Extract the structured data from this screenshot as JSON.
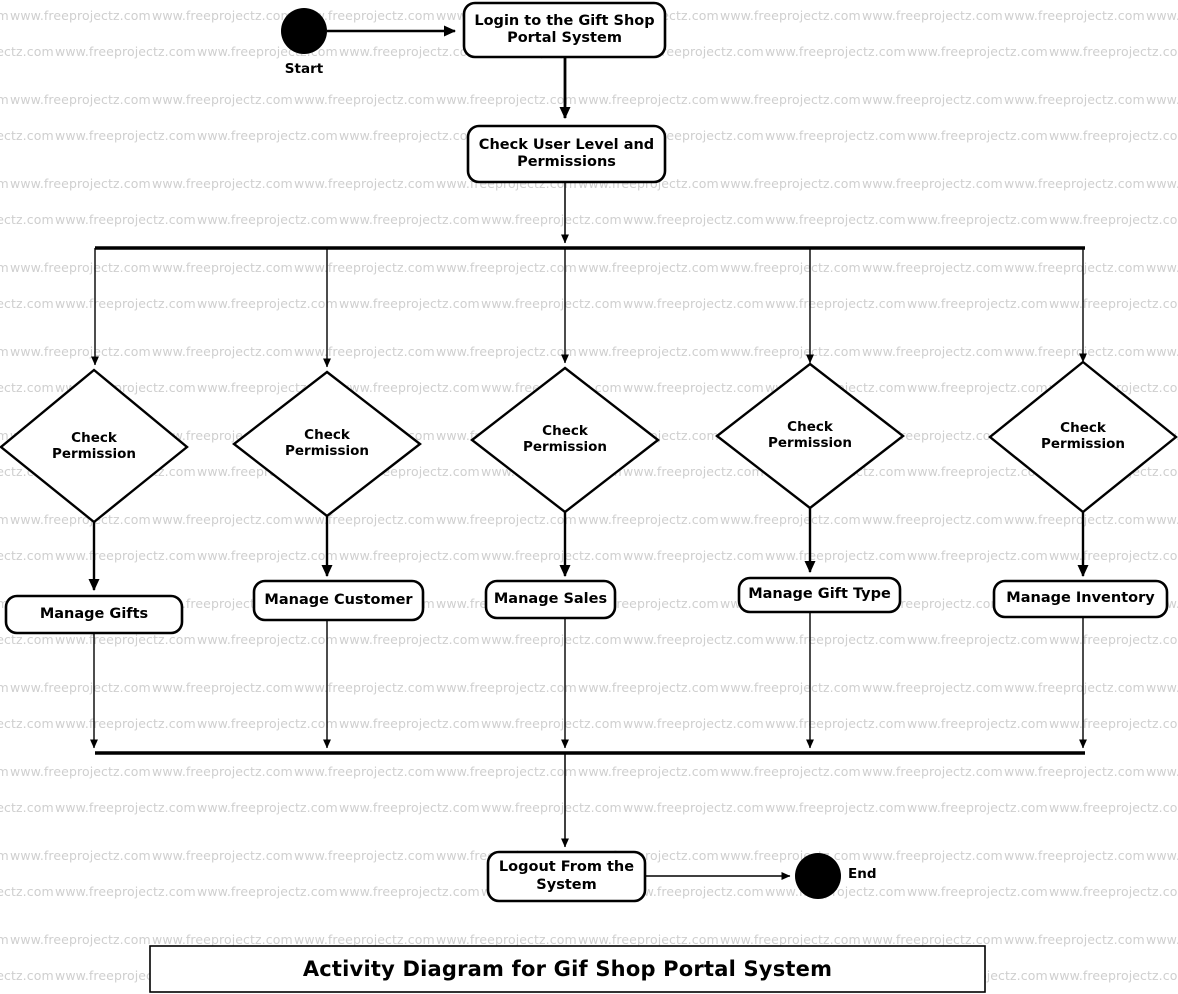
{
  "diagram": {
    "title": "Activity Diagram for Gif Shop Portal System",
    "watermark_text": "www.freeprojectz.com",
    "colors": {
      "stroke": "#000000",
      "fill": "#ffffff",
      "watermark": "#cfcfcf",
      "background": "#ffffff"
    },
    "start_node": {
      "label": "Start"
    },
    "end_node": {
      "label": "End"
    },
    "activities": {
      "login": "Login to the Gift Shop\nPortal System",
      "check_user": "Check User Level and\nPermissions",
      "logout": "Logout From the\nSystem"
    },
    "decisions": [
      {
        "label": "Check\nPermission"
      },
      {
        "label": "Check\nPermission"
      },
      {
        "label": "Check\nPermission"
      },
      {
        "label": "Check\nPermission"
      },
      {
        "label": "Check\nPermission"
      }
    ],
    "branch_activities": [
      {
        "label": "Manage Gifts"
      },
      {
        "label": "Manage Customer"
      },
      {
        "label": "Manage Sales"
      },
      {
        "label": "Manage Gift Type"
      },
      {
        "label": "Manage Inventory"
      }
    ]
  }
}
